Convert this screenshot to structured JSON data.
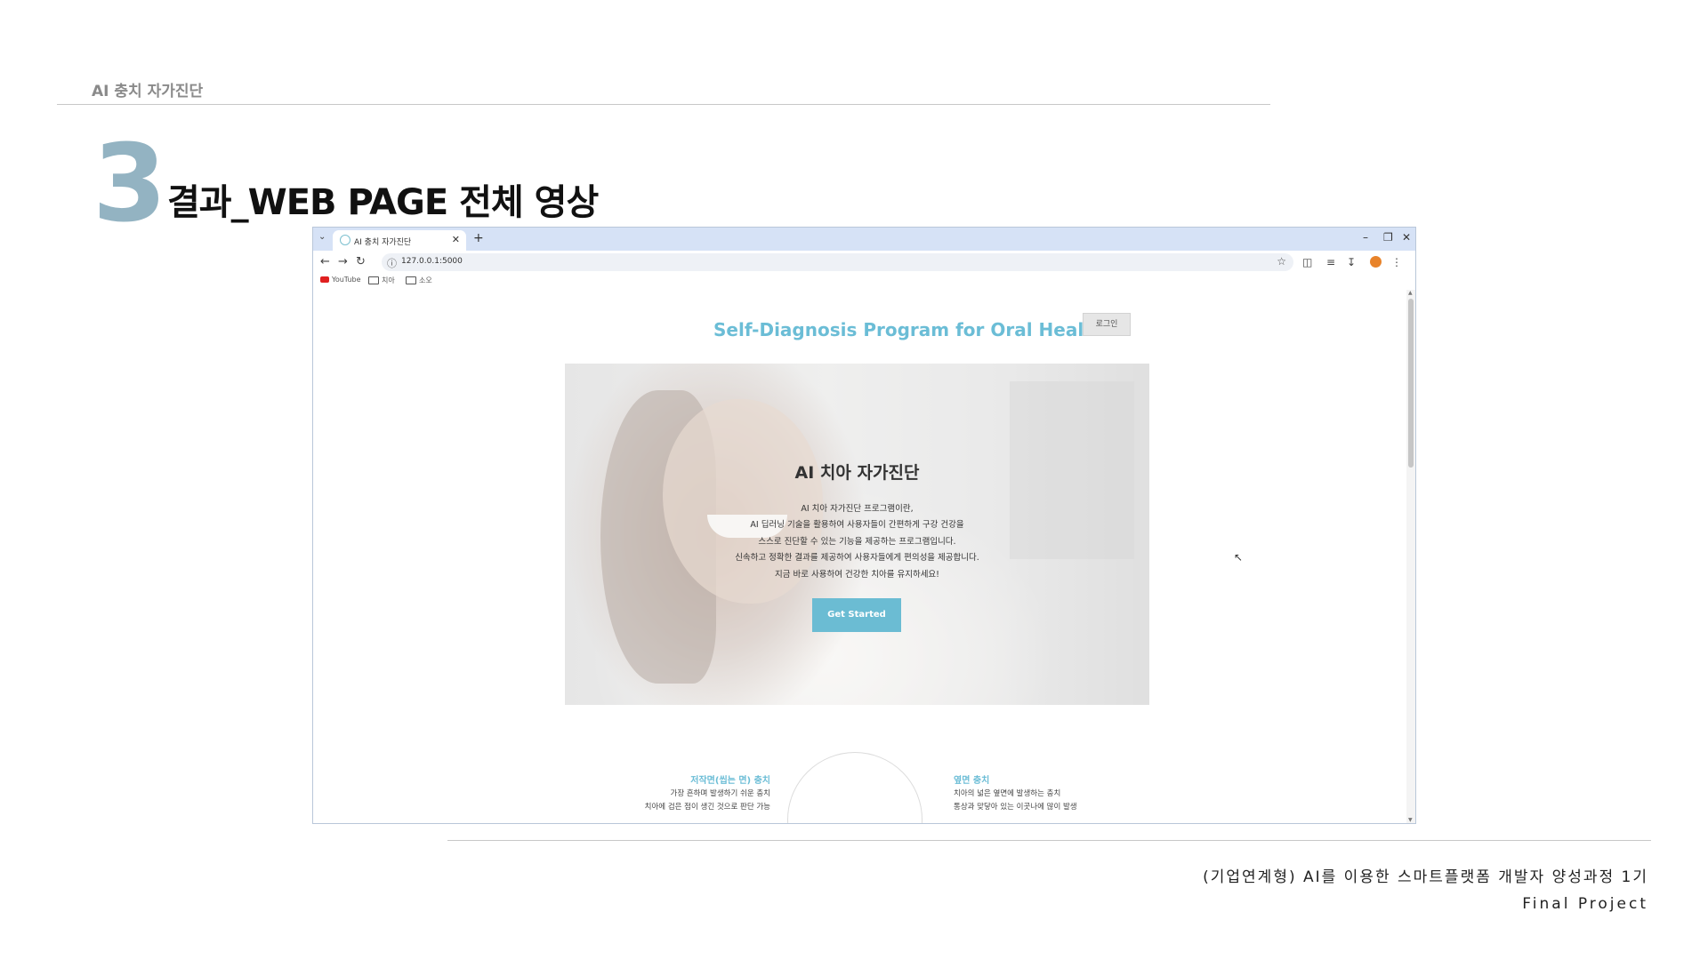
{
  "slide": {
    "header": "AI 충치 자가진단",
    "section_number": "3",
    "section_title": "결과_WEB PAGE 전체 영상",
    "footer_line1": "(기업연계형) AI를 이용한 스마트플랫폼 개발자 양성과정 1기",
    "footer_line2": "Final Project"
  },
  "browser": {
    "tab_title": "AI 충치 자가진단",
    "url": "127.0.0.1:5000",
    "bookmarks": [
      "YouTube",
      "치아",
      "소오"
    ]
  },
  "page": {
    "site_title": "Self-Diagnosis Program for Oral Health",
    "login_label": "로그인",
    "hero": {
      "heading": "AI 치아 자가진단",
      "lines": [
        "AI 치아 자가진단 프로그램이란,",
        "AI 딥러닝 기술을 활용하여 사용자들이 간편하게 구강 건강을",
        "스스로 진단할 수 있는 기능을 제공하는 프로그램입니다.",
        "신속하고 정확한 결과를 제공하여 사용자들에게 편의성을 제공합니다.",
        "지금 바로 사용하여 건강한 치아를 유지하세요!"
      ],
      "cta_label": "Get Started"
    },
    "features": [
      {
        "title": "저작면(씹는 면) 충치",
        "lines": [
          "가장 흔하며 발생하기 쉬운 충치",
          "치아에 검은 점이 생긴 것으로 판단 가능"
        ]
      },
      {
        "title": "옆면 충치",
        "lines": [
          "치아의 넓은 옆면에 발생하는 충치",
          "통상과 맞닿아 있는 이곳나에 많이 발생"
        ]
      }
    ]
  },
  "colors": {
    "accent": "#6bbdd6",
    "number": "#93b3c2",
    "tabbar": "#d6e2f6"
  }
}
